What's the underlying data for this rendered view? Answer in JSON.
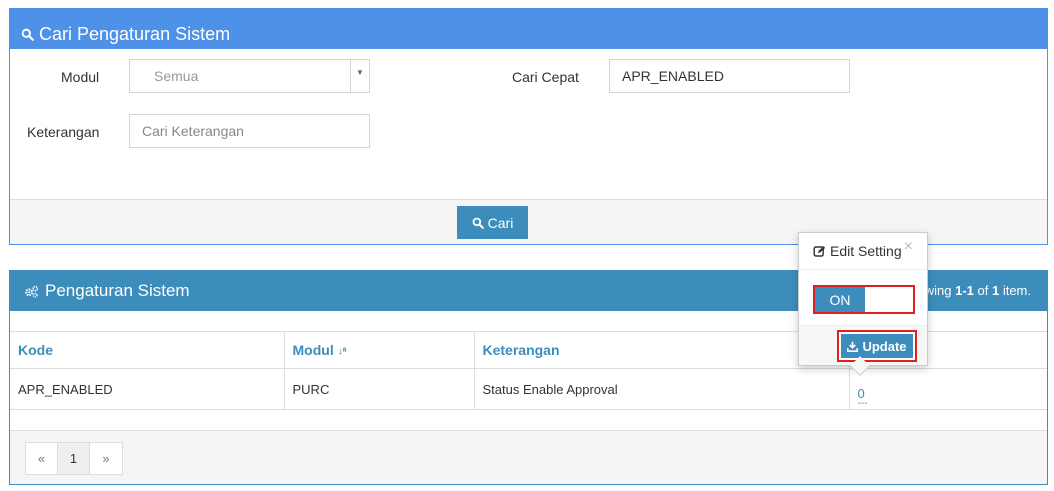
{
  "search_panel": {
    "title": "Cari Pengaturan Sistem",
    "modul_label": "Modul",
    "modul_value": "Semua",
    "cari_cepat_label": "Cari Cepat",
    "cari_cepat_value": "APR_ENABLED",
    "keterangan_label": "Keterangan",
    "keterangan_placeholder": "Cari Keterangan",
    "cari_button": "Cari"
  },
  "settings_panel": {
    "title": "Pengaturan Sistem",
    "summary_prefix": "wing ",
    "summary_range": "1-1",
    "summary_of": " of ",
    "summary_total": "1",
    "summary_suffix": " item.",
    "columns": [
      "Kode",
      "Modul",
      "Keterangan",
      ""
    ],
    "rows": [
      {
        "kode": "APR_ENABLED",
        "modul": "PURC",
        "keterangan": "Status Enable Approval",
        "value": "0",
        "underline": "---"
      }
    ],
    "pager": {
      "prev": "«",
      "page": "1",
      "next": "»"
    }
  },
  "popover": {
    "title": "Edit Setting",
    "close": "×",
    "switch_on": "ON",
    "update_button": "Update"
  },
  "colors": {
    "header_search": "#4e91e8",
    "header_settings": "#3c8dbc",
    "highlight": "#e02020"
  }
}
